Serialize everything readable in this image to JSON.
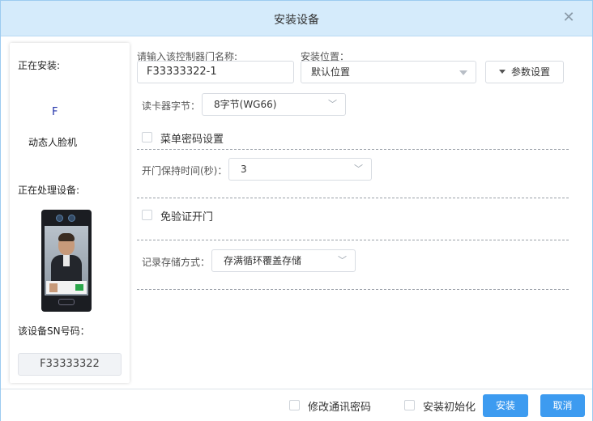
{
  "dialog": {
    "title": "安装设备",
    "close_icon": "close-icon"
  },
  "left_panel": {
    "installing_label": "正在安装:",
    "model": "F",
    "device_type": "动态人脸机",
    "processing_label": "正在处理设备:",
    "sn_label": "该设备SN号码：",
    "sn_value": "F33333322"
  },
  "form": {
    "door_name_label": "请输入该控制器门名称:",
    "door_name_value": "F33333322-1",
    "location_label": "安装位置：",
    "location_value": "默认位置",
    "param_button": "参数设置",
    "card_bytes_label": "读卡器字节：",
    "card_bytes_value": "8字节(WG66)",
    "menu_password_label": "菜单密码设置",
    "door_hold_label": "开门保持时间(秒)：",
    "door_hold_value": "3",
    "no_verify_label": "免验证开门",
    "record_storage_label": "记录存储方式：",
    "record_storage_value": "存满循环覆盖存储"
  },
  "footer": {
    "change_password_label": "修改通讯密码",
    "install_init_label": "安装初始化",
    "install_button": "安装",
    "cancel_button": "取消"
  },
  "colors": {
    "titlebar_bg": "#d5ebfb",
    "primary_button": "#3d9bf0"
  }
}
